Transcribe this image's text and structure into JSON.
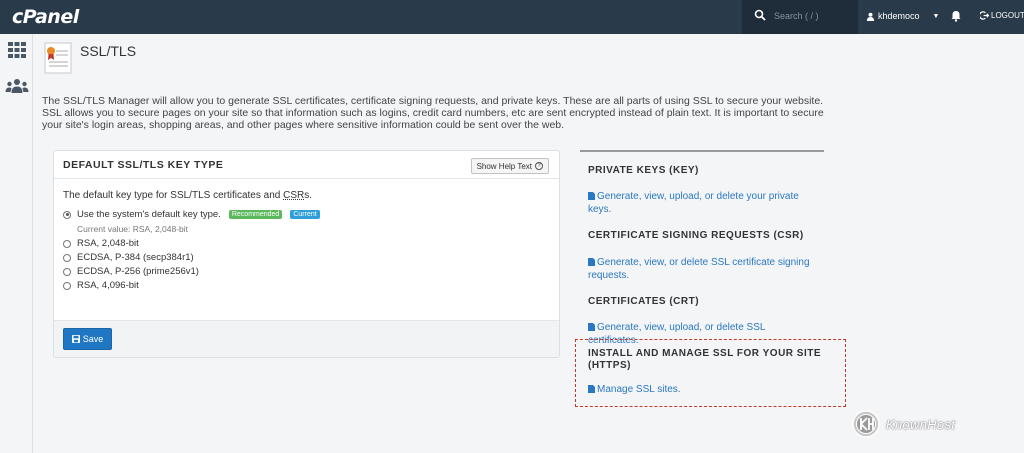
{
  "topbar": {
    "logo": "cPanel",
    "search_placeholder": "Search ( / )",
    "username": "khdemoco",
    "logout_label": "LOGOUT"
  },
  "page": {
    "title": "SSL/TLS",
    "intro": "The SSL/TLS Manager will allow you to generate SSL certificates, certificate signing requests, and private keys. These are all parts of using SSL to secure your website. SSL allows you to secure pages on your site so that information such as logins, credit card numbers, etc are sent encrypted instead of plain text. It is important to secure your site's login areas, shopping areas, and other pages where sensitive information could be sent over the web."
  },
  "key_panel": {
    "title": "DEFAULT SSL/TLS KEY TYPE",
    "help_button": "Show Help Text",
    "description_prefix": "The default key type for SSL/TLS certificates and ",
    "description_abbr": "CSR",
    "description_suffix": "s.",
    "options": [
      {
        "label": "Use the system's default key type.",
        "selected": true
      },
      {
        "label": "RSA, 2,048-bit",
        "selected": false
      },
      {
        "label": "ECDSA, P-384 (secp384r1)",
        "selected": false
      },
      {
        "label": "ECDSA, P-256 (prime256v1)",
        "selected": false
      },
      {
        "label": "RSA, 4,096-bit",
        "selected": false
      }
    ],
    "badge_recommended": "Recommended",
    "badge_current": "Current",
    "current_value": "Current value: RSA, 2,048-bit",
    "save_button": "Save"
  },
  "sections": [
    {
      "heading": "PRIVATE KEYS (KEY)",
      "link": "Generate, view, upload, or delete your private keys."
    },
    {
      "heading": "CERTIFICATE SIGNING REQUESTS (CSR)",
      "link": "Generate, view, or delete SSL certificate signing requests."
    },
    {
      "heading": "CERTIFICATES (CRT)",
      "link": "Generate, view, upload, or delete SSL certificates."
    },
    {
      "heading": "INSTALL AND MANAGE SSL FOR YOUR SITE (HTTPS)",
      "link": "Manage SSL sites."
    }
  ],
  "watermark": "KnownHost",
  "colors": {
    "topbar": "#293a4a",
    "link": "#2a78c2",
    "save_button": "#1f76c2",
    "highlight_border": "#c0392b",
    "badge_green": "#5cb85c",
    "badge_blue": "#2e9fd8"
  }
}
